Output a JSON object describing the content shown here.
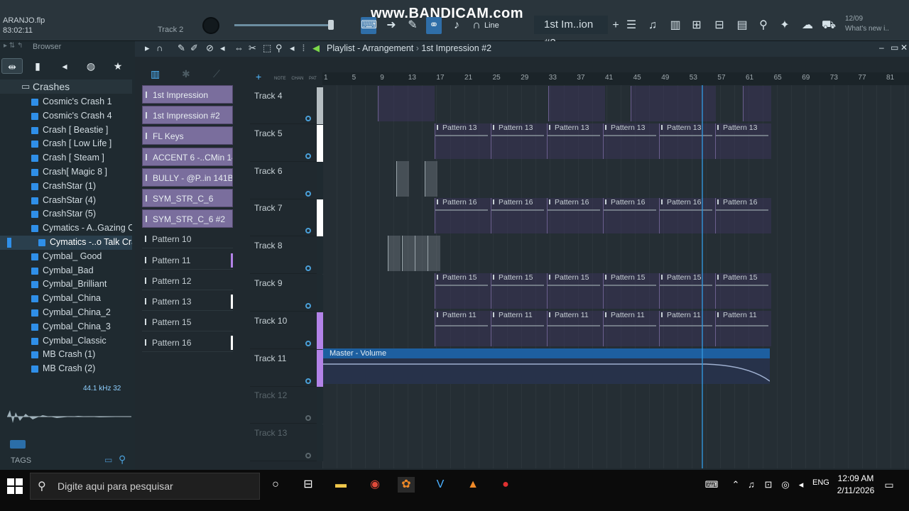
{
  "toolbar": {
    "project_name": "ARANJO.flp",
    "time": "83:02:11",
    "track_label": "Track 2",
    "watermark": "www.BANDICAM.com",
    "snap": "Line",
    "pattern_selector": "1st Im..ion #2",
    "hint_number": "12/09",
    "hint_text": "What's new i.."
  },
  "browser": {
    "title": "Browser",
    "folder": "Crashes",
    "items": [
      "Cosmic's Crash 1",
      "Cosmic's Crash 4",
      "Crash [ Beastie ]",
      "Crash [ Low Life ]",
      "Crash [ Steam ]",
      "Crash[ Magic 8 ]",
      "CrashStar (1)",
      "CrashStar (4)",
      "CrashStar (5)",
      "Cymatics - A..Gazing Crash",
      "Cymatics -..o Talk Crash",
      "Cymbal_ Good",
      "Cymbal_Bad",
      "Cymbal_Brilliant",
      "Cymbal_China",
      "Cymbal_China_2",
      "Cymbal_China_3",
      "Cymbal_Classic",
      "MB Crash (1)",
      "MB Crash (2)"
    ],
    "selected_index": 10,
    "sample_rate": "44.1 kHz 32",
    "tags_label": "TAGS"
  },
  "playlist": {
    "title": "Playlist - Arrangement",
    "pattern_name": "1st Impression #2",
    "ruler": [
      "1",
      "5",
      "9",
      "13",
      "17",
      "21",
      "25",
      "29",
      "33",
      "37",
      "41",
      "45",
      "49",
      "53",
      "57",
      "61",
      "65",
      "69",
      "73",
      "77",
      "81"
    ],
    "picker_columns": [
      "NOTE",
      "CHAN",
      "PAT"
    ],
    "picker": [
      {
        "label": "1st Impression",
        "kind": "c"
      },
      {
        "label": "1st Impression #2",
        "kind": "c"
      },
      {
        "label": "FL Keys",
        "kind": "c"
      },
      {
        "label": "ACCENT 6 -..CMin 141BPM",
        "kind": "c"
      },
      {
        "label": "BULLY - @P..in 141BPM",
        "kind": "c"
      },
      {
        "label": "SYM_STR_C_6",
        "kind": "c"
      },
      {
        "label": "SYM_STR_C_6 #2",
        "kind": "c"
      },
      {
        "label": "Pattern 10",
        "kind": "p"
      },
      {
        "label": "Pattern 11",
        "kind": "p"
      },
      {
        "label": "Pattern 12",
        "kind": "p"
      },
      {
        "label": "Pattern 13",
        "kind": "p"
      },
      {
        "label": "Pattern 15",
        "kind": "p"
      },
      {
        "label": "Pattern 16",
        "kind": "p"
      }
    ],
    "tracks": [
      "Track 4",
      "Track 5",
      "Track 6",
      "Track 7",
      "Track 8",
      "Track 9",
      "Track 10",
      "Track 11",
      "Track 12",
      "Track 13"
    ],
    "clip_rows": [
      {
        "track": 1,
        "label": "Pattern 13"
      },
      {
        "track": 3,
        "label": "Pattern 16"
      },
      {
        "track": 5,
        "label": "Pattern 15"
      },
      {
        "track": 6,
        "label": "Pattern 11"
      }
    ],
    "automation_label": "Master - Volume"
  },
  "taskbar": {
    "search_placeholder": "Digite aqui para pesquisar",
    "language": "ENG",
    "time": "12:09 AM",
    "date": "2/11/2026"
  }
}
